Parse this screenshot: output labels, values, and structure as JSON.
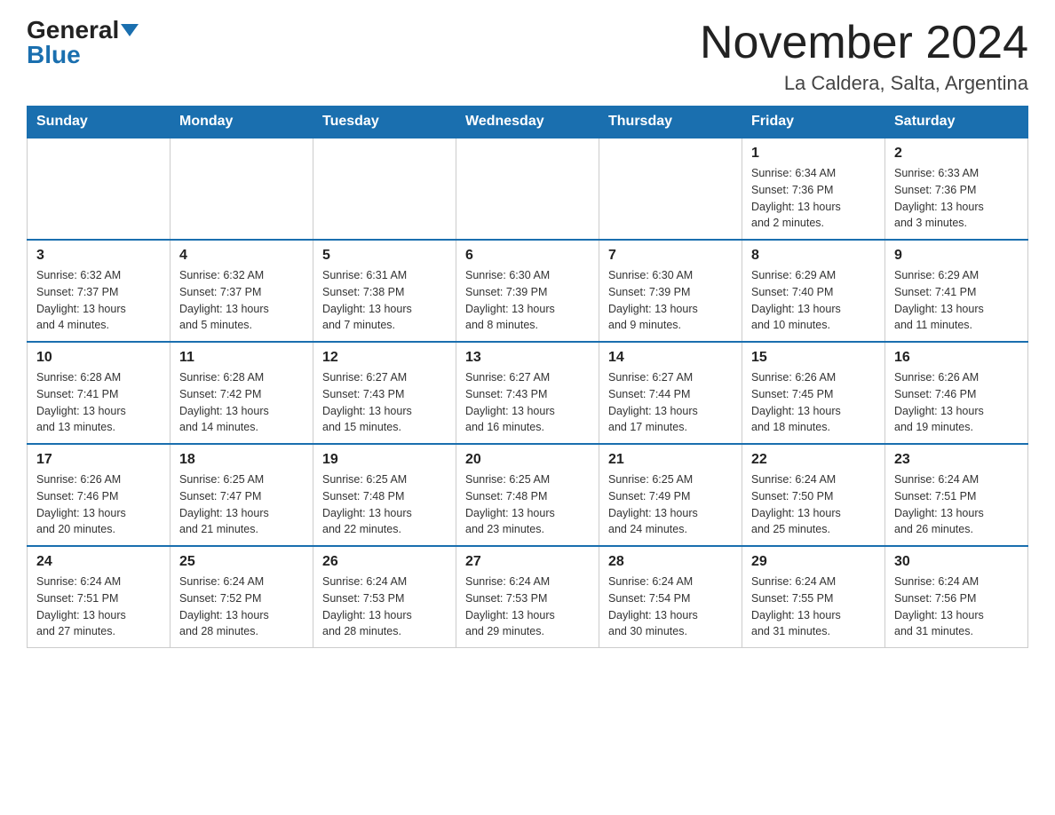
{
  "header": {
    "logo_general": "General",
    "logo_blue": "Blue",
    "month_year": "November 2024",
    "location": "La Caldera, Salta, Argentina"
  },
  "days_of_week": [
    "Sunday",
    "Monday",
    "Tuesday",
    "Wednesday",
    "Thursday",
    "Friday",
    "Saturday"
  ],
  "weeks": [
    {
      "days": [
        {
          "number": "",
          "info": ""
        },
        {
          "number": "",
          "info": ""
        },
        {
          "number": "",
          "info": ""
        },
        {
          "number": "",
          "info": ""
        },
        {
          "number": "",
          "info": ""
        },
        {
          "number": "1",
          "info": "Sunrise: 6:34 AM\nSunset: 7:36 PM\nDaylight: 13 hours\nand 2 minutes."
        },
        {
          "number": "2",
          "info": "Sunrise: 6:33 AM\nSunset: 7:36 PM\nDaylight: 13 hours\nand 3 minutes."
        }
      ]
    },
    {
      "days": [
        {
          "number": "3",
          "info": "Sunrise: 6:32 AM\nSunset: 7:37 PM\nDaylight: 13 hours\nand 4 minutes."
        },
        {
          "number": "4",
          "info": "Sunrise: 6:32 AM\nSunset: 7:37 PM\nDaylight: 13 hours\nand 5 minutes."
        },
        {
          "number": "5",
          "info": "Sunrise: 6:31 AM\nSunset: 7:38 PM\nDaylight: 13 hours\nand 7 minutes."
        },
        {
          "number": "6",
          "info": "Sunrise: 6:30 AM\nSunset: 7:39 PM\nDaylight: 13 hours\nand 8 minutes."
        },
        {
          "number": "7",
          "info": "Sunrise: 6:30 AM\nSunset: 7:39 PM\nDaylight: 13 hours\nand 9 minutes."
        },
        {
          "number": "8",
          "info": "Sunrise: 6:29 AM\nSunset: 7:40 PM\nDaylight: 13 hours\nand 10 minutes."
        },
        {
          "number": "9",
          "info": "Sunrise: 6:29 AM\nSunset: 7:41 PM\nDaylight: 13 hours\nand 11 minutes."
        }
      ]
    },
    {
      "days": [
        {
          "number": "10",
          "info": "Sunrise: 6:28 AM\nSunset: 7:41 PM\nDaylight: 13 hours\nand 13 minutes."
        },
        {
          "number": "11",
          "info": "Sunrise: 6:28 AM\nSunset: 7:42 PM\nDaylight: 13 hours\nand 14 minutes."
        },
        {
          "number": "12",
          "info": "Sunrise: 6:27 AM\nSunset: 7:43 PM\nDaylight: 13 hours\nand 15 minutes."
        },
        {
          "number": "13",
          "info": "Sunrise: 6:27 AM\nSunset: 7:43 PM\nDaylight: 13 hours\nand 16 minutes."
        },
        {
          "number": "14",
          "info": "Sunrise: 6:27 AM\nSunset: 7:44 PM\nDaylight: 13 hours\nand 17 minutes."
        },
        {
          "number": "15",
          "info": "Sunrise: 6:26 AM\nSunset: 7:45 PM\nDaylight: 13 hours\nand 18 minutes."
        },
        {
          "number": "16",
          "info": "Sunrise: 6:26 AM\nSunset: 7:46 PM\nDaylight: 13 hours\nand 19 minutes."
        }
      ]
    },
    {
      "days": [
        {
          "number": "17",
          "info": "Sunrise: 6:26 AM\nSunset: 7:46 PM\nDaylight: 13 hours\nand 20 minutes."
        },
        {
          "number": "18",
          "info": "Sunrise: 6:25 AM\nSunset: 7:47 PM\nDaylight: 13 hours\nand 21 minutes."
        },
        {
          "number": "19",
          "info": "Sunrise: 6:25 AM\nSunset: 7:48 PM\nDaylight: 13 hours\nand 22 minutes."
        },
        {
          "number": "20",
          "info": "Sunrise: 6:25 AM\nSunset: 7:48 PM\nDaylight: 13 hours\nand 23 minutes."
        },
        {
          "number": "21",
          "info": "Sunrise: 6:25 AM\nSunset: 7:49 PM\nDaylight: 13 hours\nand 24 minutes."
        },
        {
          "number": "22",
          "info": "Sunrise: 6:24 AM\nSunset: 7:50 PM\nDaylight: 13 hours\nand 25 minutes."
        },
        {
          "number": "23",
          "info": "Sunrise: 6:24 AM\nSunset: 7:51 PM\nDaylight: 13 hours\nand 26 minutes."
        }
      ]
    },
    {
      "days": [
        {
          "number": "24",
          "info": "Sunrise: 6:24 AM\nSunset: 7:51 PM\nDaylight: 13 hours\nand 27 minutes."
        },
        {
          "number": "25",
          "info": "Sunrise: 6:24 AM\nSunset: 7:52 PM\nDaylight: 13 hours\nand 28 minutes."
        },
        {
          "number": "26",
          "info": "Sunrise: 6:24 AM\nSunset: 7:53 PM\nDaylight: 13 hours\nand 28 minutes."
        },
        {
          "number": "27",
          "info": "Sunrise: 6:24 AM\nSunset: 7:53 PM\nDaylight: 13 hours\nand 29 minutes."
        },
        {
          "number": "28",
          "info": "Sunrise: 6:24 AM\nSunset: 7:54 PM\nDaylight: 13 hours\nand 30 minutes."
        },
        {
          "number": "29",
          "info": "Sunrise: 6:24 AM\nSunset: 7:55 PM\nDaylight: 13 hours\nand 31 minutes."
        },
        {
          "number": "30",
          "info": "Sunrise: 6:24 AM\nSunset: 7:56 PM\nDaylight: 13 hours\nand 31 minutes."
        }
      ]
    }
  ]
}
